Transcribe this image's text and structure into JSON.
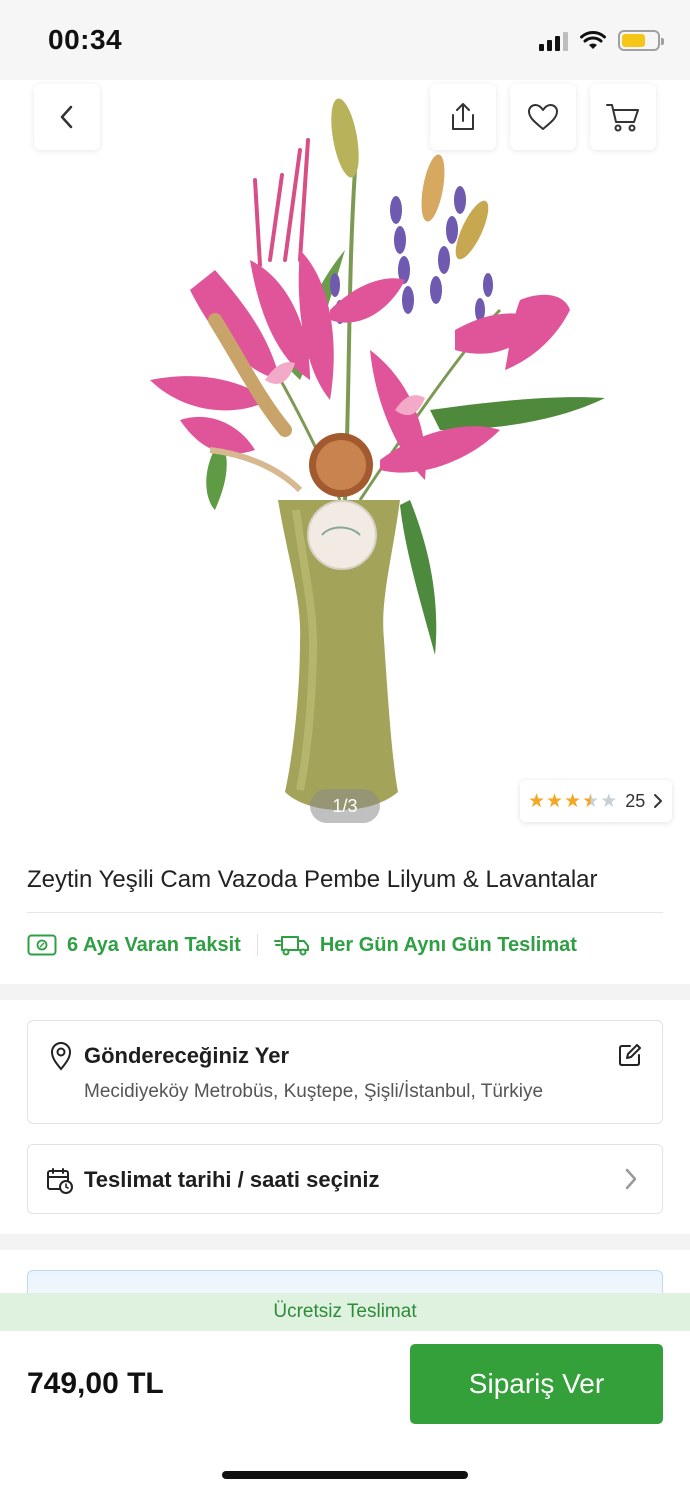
{
  "status_bar": {
    "time": "00:34",
    "icons": [
      "signal-icon",
      "wifi-icon",
      "battery-icon"
    ],
    "battery_color": "#f5c518"
  },
  "gallery": {
    "image_subject": "pink lilies and lavender in olive green glass vase",
    "counter": "1/3",
    "buttons": [
      "back-icon",
      "share-icon",
      "heart-icon",
      "cart-icon"
    ]
  },
  "rating": {
    "stars": 3.5,
    "max": 5,
    "count": "25"
  },
  "product": {
    "title": "Zeytin Yeşili Cam Vazoda Pembe Lilyum & Lavantalar"
  },
  "features": [
    {
      "label": "6 Aya Varan Taksit",
      "icon": "payment-card-icon"
    },
    {
      "label": "Her Gün Aynı Gün Teslimat",
      "icon": "delivery-truck-icon"
    }
  ],
  "delivery": {
    "address_label": "Göndereceğiniz Yer",
    "address_value": "Mecidiyeköy Metrobüs, Kuştepe, Şişli/İstanbul, Türkiye",
    "date_label": "Teslimat tarihi / saati seçiniz"
  },
  "bottom": {
    "free_delivery": "Ücretsiz Teslimat",
    "price": "749,00 TL",
    "order_button": "Sipariş Ver"
  },
  "colors": {
    "accent_green": "#34a03a",
    "feature_green": "#2ea043",
    "star_gold": "#f5a623",
    "star_empty": "#c7d0d6"
  }
}
